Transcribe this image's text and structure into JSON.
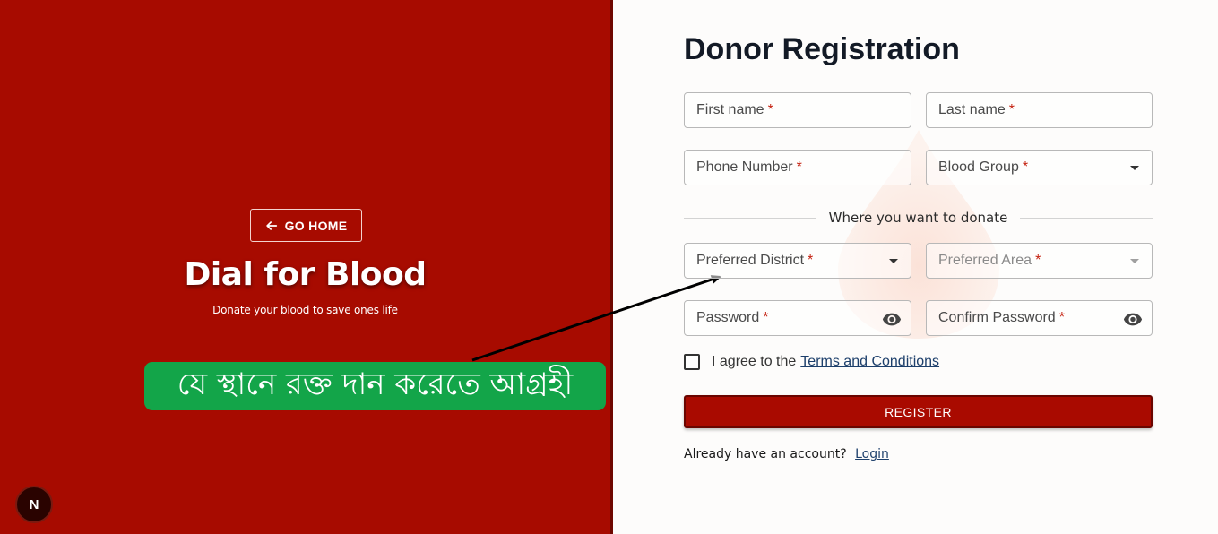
{
  "left": {
    "go_home_label": "GO HOME",
    "brand_title": "Dial for Blood",
    "brand_subtitle": "Donate your blood to save ones life",
    "annotation_text": "যে স্থানে রক্ত দান করেতে আগ্রহী",
    "badge_letter": "N"
  },
  "form": {
    "title": "Donor Registration",
    "first_name": "First name",
    "last_name": "Last name",
    "phone": "Phone Number",
    "blood_group": "Blood Group",
    "section_label": "Where you want to donate",
    "district": "Preferred District",
    "area": "Preferred Area",
    "password": "Password",
    "confirm_password": "Confirm Password",
    "required_mark": "*",
    "agree_prefix": "I agree to the",
    "terms_link": "Terms and Conditions",
    "register_label": "REGISTER",
    "login_prompt": "Already have an account?",
    "login_link": "Login"
  },
  "colors": {
    "brand_red": "#a70b00",
    "annotation_green": "#13a549",
    "required_star": "#c41f0e"
  },
  "icons": [
    "arrow-left-icon",
    "chevron-down-icon",
    "eye-icon",
    "blood-drop-icon"
  ]
}
